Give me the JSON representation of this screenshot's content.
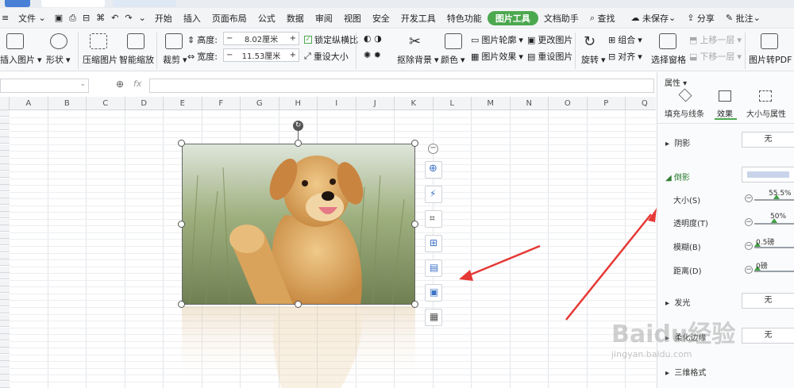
{
  "titlebar": {
    "tabs": [
      "Ahh",
      "…",
      "…"
    ]
  },
  "menubar": {
    "file": "文件",
    "items": [
      "开始",
      "插入",
      "页面布局",
      "公式",
      "数据",
      "审阅",
      "视图",
      "安全",
      "开发工具",
      "特色功能",
      "图片工具",
      "文档助手"
    ],
    "active": "图片工具",
    "search": "查找",
    "unsaved": "未保存",
    "share": "分享",
    "comment": "批注"
  },
  "ribbon": {
    "insert_picture": "插入图片",
    "shape": "形状",
    "compress": "压缩图片",
    "smart_zoom": "智能缩放",
    "crop": "裁剪",
    "height_label": "高度:",
    "height_value": "8.02厘米",
    "width_label": "宽度:",
    "width_value": "11.53厘米",
    "lock_ratio": "锁定纵横比",
    "reset_size": "重设大小",
    "remove_bg": "抠除背景",
    "color": "颜色",
    "pic_outline": "图片轮廓",
    "pic_effect": "图片效果",
    "change_pic": "更改图片",
    "reset_pic": "重设图片",
    "rotate": "旋转",
    "group": "组合",
    "align": "对齐",
    "select_pane": "选择窗格",
    "move_up": "上移一层",
    "move_down": "下移一层",
    "pic_to_pdf": "图片转PDF"
  },
  "formulabar": {
    "fx": "fx"
  },
  "columns": [
    "A",
    "B",
    "C",
    "D",
    "E",
    "F",
    "G",
    "H",
    "I",
    "J",
    "K",
    "L",
    "M",
    "N",
    "O",
    "P",
    "Q"
  ],
  "panel": {
    "title": "属性",
    "tabs": [
      "填充与线条",
      "效果",
      "大小与属性"
    ],
    "active_tab": "效果",
    "shadow": {
      "label": "阴影",
      "value": "无"
    },
    "reflection": {
      "label": "倒影"
    },
    "size_label": "大小(S)",
    "size_value": "55.5%",
    "size_level": 0.555,
    "transparency_label": "透明度(T)",
    "transparency_value": "50%",
    "transparency_level": 0.5,
    "blur_label": "模糊(B)",
    "blur_value": "0.5磅",
    "distance_label": "距离(D)",
    "distance_value": "0磅",
    "glow": {
      "label": "发光",
      "value": "无"
    },
    "soft_edge": {
      "label": "柔化边缘",
      "value": "无"
    },
    "three_d": "三维格式"
  },
  "watermark": {
    "brand": "Baidu经验",
    "url": "jingyan.baidu.com"
  },
  "colors": {
    "accent": "#4ca84f",
    "arrow": "#e53935",
    "green": "#43a047"
  }
}
